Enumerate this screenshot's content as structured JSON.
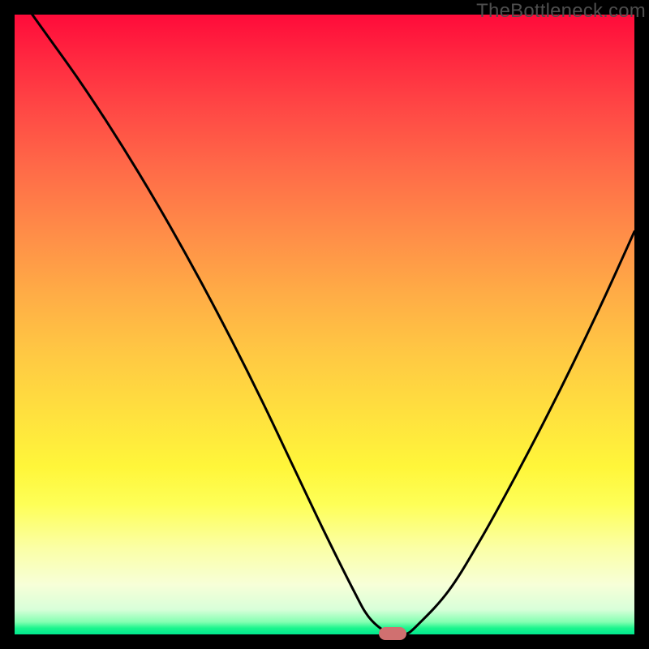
{
  "watermark": "TheBottleneck.com",
  "colors": {
    "frame": "#000000",
    "curve_stroke": "#000000",
    "marker_fill": "#d07070"
  },
  "chart_data": {
    "type": "line",
    "title": "",
    "xlabel": "",
    "ylabel": "",
    "xlim": [
      0,
      100
    ],
    "ylim": [
      0,
      100
    ],
    "grid": false,
    "legend": false,
    "series": [
      {
        "name": "bottleneck-curve",
        "x": [
          0,
          5,
          10,
          15,
          20,
          25,
          30,
          35,
          40,
          45,
          50,
          55,
          57,
          59,
          61,
          63,
          65,
          70,
          75,
          80,
          85,
          90,
          95,
          100
        ],
        "y": [
          104,
          97,
          90,
          82.5,
          74.5,
          66,
          57,
          47.5,
          37.5,
          27,
          16.5,
          6.5,
          3,
          1,
          0,
          0,
          1.5,
          7,
          15,
          24,
          33.5,
          43.5,
          54,
          65
        ]
      }
    ],
    "marker": {
      "x": 61,
      "y": 0,
      "width_pct": 4.4,
      "height_pct": 2.0
    },
    "gradient_stops": [
      {
        "pct": 0,
        "color": "#ff0b3a"
      },
      {
        "pct": 7,
        "color": "#ff2840"
      },
      {
        "pct": 15,
        "color": "#ff4745"
      },
      {
        "pct": 25,
        "color": "#ff6b48"
      },
      {
        "pct": 35,
        "color": "#ff8c48"
      },
      {
        "pct": 45,
        "color": "#ffac46"
      },
      {
        "pct": 55,
        "color": "#ffc943"
      },
      {
        "pct": 65,
        "color": "#ffe23e"
      },
      {
        "pct": 73,
        "color": "#fff63a"
      },
      {
        "pct": 79,
        "color": "#feff57"
      },
      {
        "pct": 86,
        "color": "#fbffa5"
      },
      {
        "pct": 92,
        "color": "#f7ffd8"
      },
      {
        "pct": 96,
        "color": "#d8ffd9"
      },
      {
        "pct": 98,
        "color": "#84ffb1"
      },
      {
        "pct": 99,
        "color": "#1bf58d"
      },
      {
        "pct": 100,
        "color": "#00e88e"
      }
    ]
  }
}
